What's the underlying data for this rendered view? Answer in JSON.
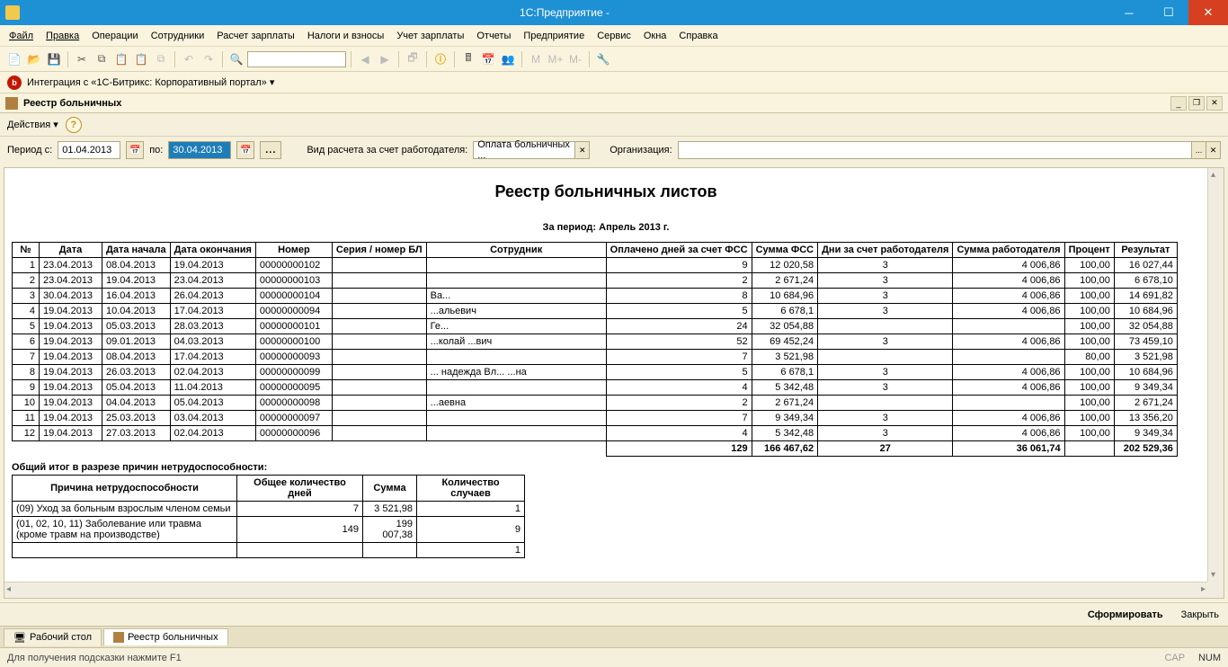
{
  "app": {
    "title": "1С:Предприятие - "
  },
  "menu": [
    "Файл",
    "Правка",
    "Операции",
    "Сотрудники",
    "Расчет зарплаты",
    "Налоги и взносы",
    "Учет зарплаты",
    "Отчеты",
    "Предприятие",
    "Сервис",
    "Окна",
    "Справка"
  ],
  "bitrix": {
    "label": "Интеграция с «1С-Битрикс: Корпоративный портал» ▾"
  },
  "doc_title": "Реестр больничных",
  "actions_label": "Действия ▾",
  "filters": {
    "period_from_lbl": "Период с:",
    "date_from": "01.04.2013",
    "to_lbl": "по:",
    "date_to": "30.04.2013",
    "calc_type_lbl": "Вид расчета за счет работодателя:",
    "calc_type_val": "Оплата больничных ...",
    "org_lbl": "Организация:",
    "org_val": ""
  },
  "report": {
    "title": "Реестр больничных листов",
    "subtitle": "",
    "period": "За период: Апрель 2013 г.",
    "headers": [
      "№",
      "Дата",
      "Дата начала",
      "Дата окончания",
      "Номер",
      "Серия / номер БЛ",
      "Сотрудник",
      "Оплачено дней за счет ФСС",
      "Сумма ФСС",
      "Дни за счет работодателя",
      "Сумма работодателя",
      "Процент",
      "Результат"
    ],
    "rows": [
      {
        "n": "1",
        "d": "23.04.2013",
        "ds": "08.04.2013",
        "de": "19.04.2013",
        "num": "00000000102",
        "ser": "",
        "emp": "",
        "days": "9",
        "fss": "12 020,58",
        "empd": "3",
        "emps": "4 006,86",
        "pct": "100,00",
        "res": "16 027,44"
      },
      {
        "n": "2",
        "d": "23.04.2013",
        "ds": "19.04.2013",
        "de": "23.04.2013",
        "num": "00000000103",
        "ser": "",
        "emp": "",
        "days": "2",
        "fss": "2 671,24",
        "empd": "3",
        "emps": "4 006,86",
        "pct": "100,00",
        "res": "6 678,10"
      },
      {
        "n": "3",
        "d": "30.04.2013",
        "ds": "16.04.2013",
        "de": "26.04.2013",
        "num": "00000000104",
        "ser": "",
        "emp": "Ва...",
        "days": "8",
        "fss": "10 684,96",
        "empd": "3",
        "emps": "4 006,86",
        "pct": "100,00",
        "res": "14 691,82"
      },
      {
        "n": "4",
        "d": "19.04.2013",
        "ds": "10.04.2013",
        "de": "17.04.2013",
        "num": "00000000094",
        "ser": "",
        "emp": "...альевич",
        "days": "5",
        "fss": "6 678,1",
        "empd": "3",
        "emps": "4 006,86",
        "pct": "100,00",
        "res": "10 684,96"
      },
      {
        "n": "5",
        "d": "19.04.2013",
        "ds": "05.03.2013",
        "de": "28.03.2013",
        "num": "00000000101",
        "ser": "",
        "emp": "Ге...",
        "days": "24",
        "fss": "32 054,88",
        "empd": "",
        "emps": "",
        "pct": "100,00",
        "res": "32 054,88"
      },
      {
        "n": "6",
        "d": "19.04.2013",
        "ds": "09.01.2013",
        "de": "04.03.2013",
        "num": "00000000100",
        "ser": "",
        "emp": "...колай ...вич",
        "days": "52",
        "fss": "69 452,24",
        "empd": "3",
        "emps": "4 006,86",
        "pct": "100,00",
        "res": "73 459,10"
      },
      {
        "n": "7",
        "d": "19.04.2013",
        "ds": "08.04.2013",
        "de": "17.04.2013",
        "num": "00000000093",
        "ser": "",
        "emp": "",
        "days": "7",
        "fss": "3 521,98",
        "empd": "",
        "emps": "",
        "pct": "80,00",
        "res": "3 521,98"
      },
      {
        "n": "8",
        "d": "19.04.2013",
        "ds": "26.03.2013",
        "de": "02.04.2013",
        "num": "00000000099",
        "ser": "",
        "emp": "... надежда Вл... ...на",
        "days": "5",
        "fss": "6 678,1",
        "empd": "3",
        "emps": "4 006,86",
        "pct": "100,00",
        "res": "10 684,96"
      },
      {
        "n": "9",
        "d": "19.04.2013",
        "ds": "05.04.2013",
        "de": "11.04.2013",
        "num": "00000000095",
        "ser": "",
        "emp": "",
        "days": "4",
        "fss": "5 342,48",
        "empd": "3",
        "emps": "4 006,86",
        "pct": "100,00",
        "res": "9 349,34"
      },
      {
        "n": "10",
        "d": "19.04.2013",
        "ds": "04.04.2013",
        "de": "05.04.2013",
        "num": "00000000098",
        "ser": "",
        "emp": "...аевна",
        "days": "2",
        "fss": "2 671,24",
        "empd": "",
        "emps": "",
        "pct": "100,00",
        "res": "2 671,24"
      },
      {
        "n": "11",
        "d": "19.04.2013",
        "ds": "25.03.2013",
        "de": "03.04.2013",
        "num": "00000000097",
        "ser": "",
        "emp": "",
        "days": "7",
        "fss": "9 349,34",
        "empd": "3",
        "emps": "4 006,86",
        "pct": "100,00",
        "res": "13 356,20"
      },
      {
        "n": "12",
        "d": "19.04.2013",
        "ds": "27.03.2013",
        "de": "02.04.2013",
        "num": "00000000096",
        "ser": "",
        "emp": "",
        "days": "4",
        "fss": "5 342,48",
        "empd": "3",
        "emps": "4 006,86",
        "pct": "100,00",
        "res": "9 349,34"
      }
    ],
    "total": {
      "days": "129",
      "fss": "166 467,62",
      "empd": "27",
      "emps": "36 061,74",
      "res": "202 529,36"
    }
  },
  "summary": {
    "title": "Общий итог в разрезе причин нетрудоспособности:",
    "headers": [
      "Причина нетрудоспособности",
      "Общее количество дней",
      "Сумма",
      "Количество случаев"
    ],
    "rows": [
      {
        "r": "(09) Уход за больным взрослым членом семьи",
        "d": "7",
        "s": "3 521,98",
        "c": "1"
      },
      {
        "r": "(01, 02, 10, 11) Заболевание или травма (кроме травм на производстве)",
        "d": "149",
        "s": "199 007,38",
        "c": "9"
      }
    ],
    "total_count": "1"
  },
  "footer": {
    "form": "Сформировать",
    "close": "Закрыть"
  },
  "tabs": [
    {
      "label": "Рабочий стол"
    },
    {
      "label": "Реестр больничных"
    }
  ],
  "status": {
    "hint": "Для получения подсказки нажмите F1",
    "cap": "CAP",
    "num": "NUM"
  }
}
